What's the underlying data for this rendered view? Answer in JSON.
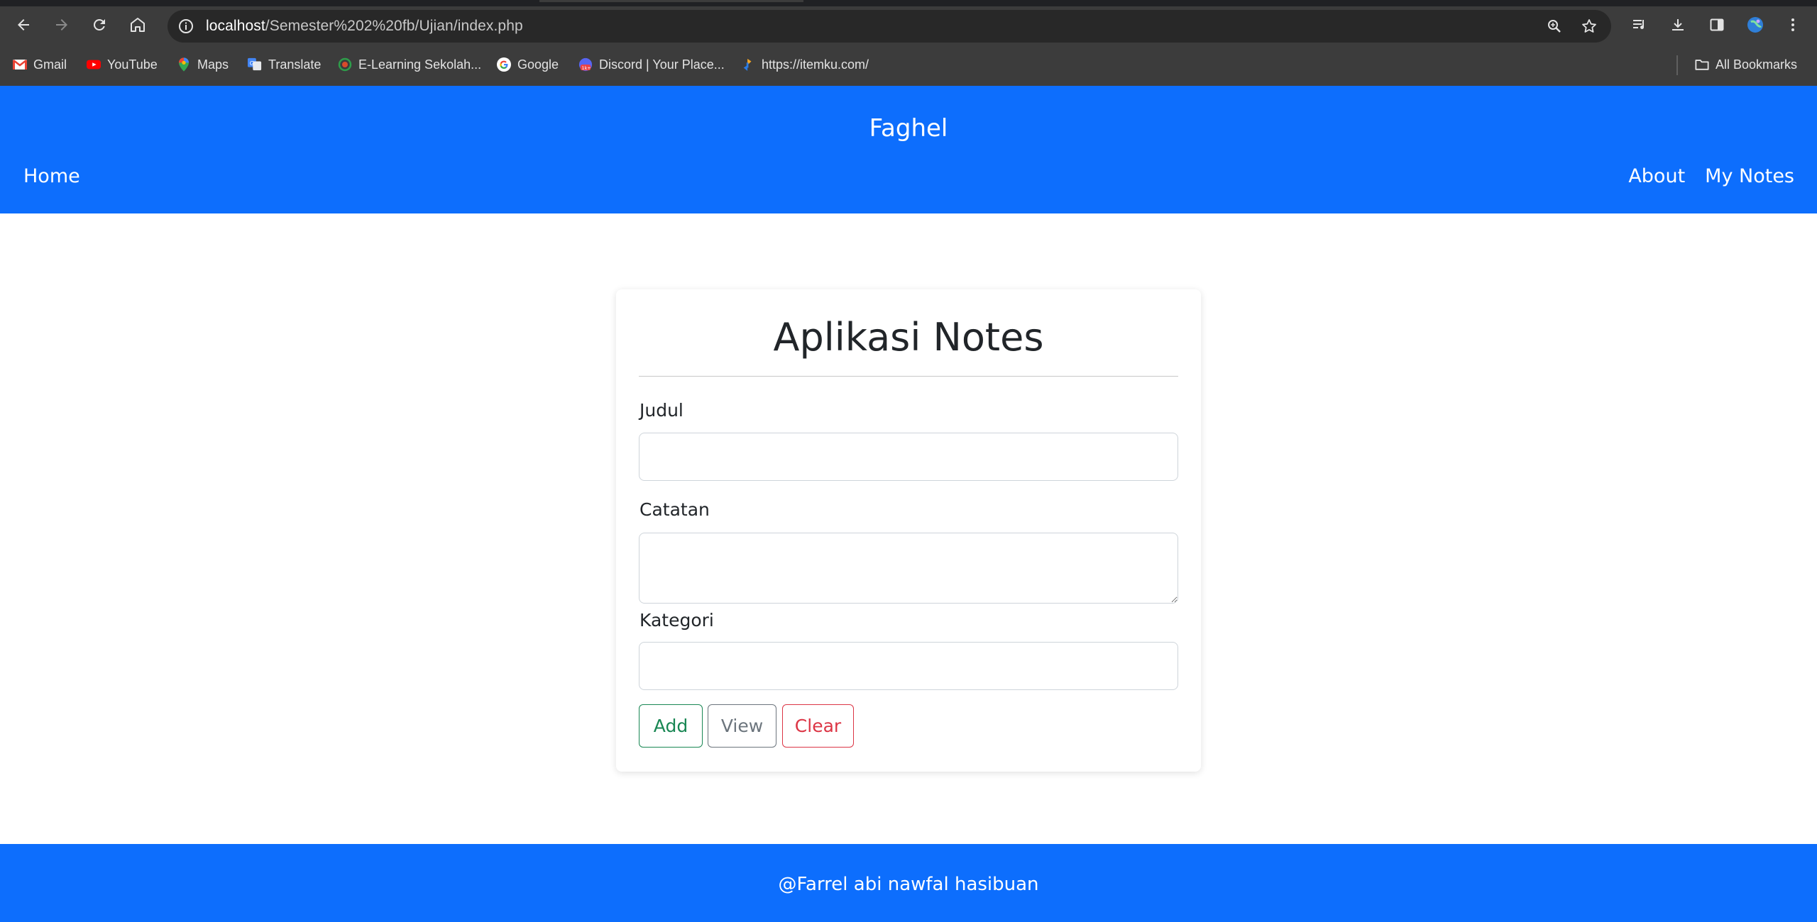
{
  "browser": {
    "url_host": "localhost",
    "url_path": "/Semester%202%20fb/Ujian/index.php",
    "bookmarks": [
      {
        "label": "Gmail",
        "icon": "gmail-icon"
      },
      {
        "label": "YouTube",
        "icon": "youtube-icon"
      },
      {
        "label": "Maps",
        "icon": "maps-icon"
      },
      {
        "label": "Translate",
        "icon": "translate-icon"
      },
      {
        "label": "E-Learning Sekolah...",
        "icon": "elearning-icon"
      },
      {
        "label": "Google",
        "icon": "google-icon"
      },
      {
        "label": "Discord | Your Place...",
        "icon": "discord-icon"
      },
      {
        "label": "https://itemku.com/",
        "icon": "itemku-icon"
      }
    ],
    "all_bookmarks": "All Bookmarks"
  },
  "header": {
    "brand": "Faghel",
    "nav_home": "Home",
    "nav_about": "About",
    "nav_my_notes": "My Notes"
  },
  "card": {
    "title": "Aplikasi Notes",
    "judul_label": "Judul",
    "judul_value": "",
    "catatan_label": "Catatan",
    "catatan_value": "",
    "kategori_label": "Kategori",
    "kategori_value": "",
    "add_button": "Add",
    "view_button": "View",
    "clear_button": "Clear"
  },
  "footer": {
    "text": "@Farrel abi nawfal hasibuan"
  },
  "colors": {
    "primary": "#0d6efd",
    "success": "#198754",
    "secondary": "#6c757d",
    "danger": "#dc3545"
  }
}
